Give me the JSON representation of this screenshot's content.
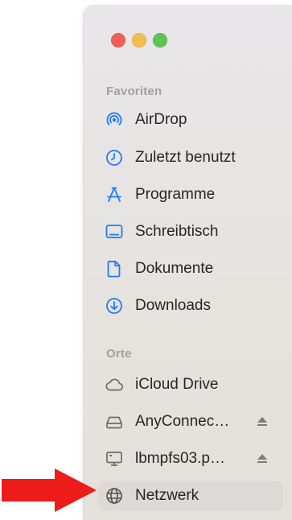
{
  "sidebar": {
    "window_controls": [
      "close",
      "minimize",
      "zoom"
    ],
    "sections": [
      {
        "header": "Favoriten",
        "items": [
          {
            "label": "AirDrop",
            "icon": "airdrop-icon"
          },
          {
            "label": "Zuletzt benutzt",
            "icon": "clock-icon"
          },
          {
            "label": "Programme",
            "icon": "applications-icon"
          },
          {
            "label": "Schreibtisch",
            "icon": "desktop-icon"
          },
          {
            "label": "Dokumente",
            "icon": "document-icon"
          },
          {
            "label": "Downloads",
            "icon": "download-icon"
          }
        ]
      },
      {
        "header": "Orte",
        "items": [
          {
            "label": "iCloud Drive",
            "icon": "cloud-icon"
          },
          {
            "label": "AnyConnec…",
            "icon": "drive-icon",
            "ejectable": true
          },
          {
            "label": "lbmpfs03.p…",
            "icon": "server-icon",
            "ejectable": true
          },
          {
            "label": "Netzwerk",
            "icon": "globe-icon",
            "selected": true
          }
        ]
      }
    ]
  },
  "colors": {
    "accent": "#1f7cf7",
    "arrow": "#ee1b1b",
    "selection": "#dcd9d6"
  }
}
